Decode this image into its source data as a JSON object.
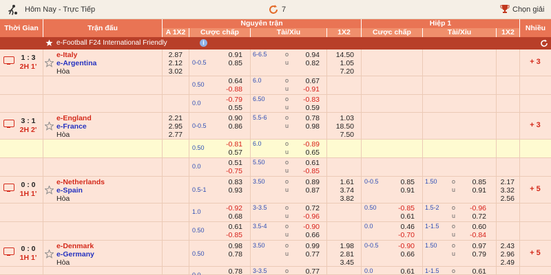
{
  "topbar": {
    "title": "Hôm Nay - Trực Tiếp",
    "count": "7",
    "choose": "Chọn giải"
  },
  "header": {
    "time": "Thời Gian",
    "match": "Trận đấu",
    "full": "Nguyên trận",
    "half": "Hiệp 1",
    "more": "Nhiều",
    "col_a1x2": "A 1X2",
    "col_handicap": "Cược chấp",
    "col_ou": "Tài/Xỉu",
    "col_1x2": "1X2",
    "col_handicap_h1": "Cược chấp",
    "col_ou_h1": "Tài/Xỉu",
    "col_1x2_h1": "1X2"
  },
  "league": {
    "name": "e-Football F24 International Friendly",
    "info": "i"
  },
  "ou_labels": {
    "over": "o",
    "under": "u"
  },
  "draw_label": "Hòa",
  "matches": [
    {
      "score": "1 : 3",
      "minute": "2H 1'",
      "home": "e-Italy",
      "away": "e-Argentina",
      "a1x2": [
        "2.87",
        "2.12",
        "3.02"
      ],
      "hc_line": "0-0.5",
      "hc_home": "0.91",
      "hc_away": "0.85",
      "ou_line": "6-6.5",
      "ou_over": "0.94",
      "ou_under": "0.82",
      "x12": [
        "14.50",
        "1.05",
        "7.20"
      ],
      "more": "+ 3",
      "subs": [
        {
          "hc_line": "0.50",
          "hc_home": "0.64",
          "hc_away": "-0.88",
          "ou_line": "6.0",
          "ou_over": "0.67",
          "ou_under": "-0.91"
        },
        {
          "hc_line": "0.0",
          "hc_home": "-0.79",
          "hc_away": "0.55",
          "ou_line": "6.50",
          "ou_over": "-0.83",
          "ou_under": "0.59"
        }
      ]
    },
    {
      "score": "3 : 1",
      "minute": "2H 2'",
      "home": "e-England",
      "away": "e-France",
      "a1x2": [
        "2.21",
        "2.95",
        "2.77"
      ],
      "hc_line": "0-0.5",
      "hc_home": "0.90",
      "hc_away": "0.86",
      "ou_line": "5.5-6",
      "ou_over": "0.78",
      "ou_under": "0.98",
      "x12": [
        "1.03",
        "18.50",
        "7.50"
      ],
      "more": "+ 3",
      "subs": [
        {
          "hc_line": "0.50",
          "hc_home": "-0.81",
          "hc_away": "0.57",
          "ou_line": "6.0",
          "ou_over": "-0.89",
          "ou_under": "0.65"
        },
        {
          "hc_line": "0.0",
          "hc_home": "0.51",
          "hc_away": "-0.75",
          "ou_line": "5.50",
          "ou_over": "0.61",
          "ou_under": "-0.85"
        }
      ]
    },
    {
      "score": "0 : 0",
      "minute": "1H 1'",
      "home": "e-Netherlands",
      "away": "e-Spain",
      "a1x2": [
        "",
        "",
        ""
      ],
      "hc_line": "0.5-1",
      "hc_home": "0.83",
      "hc_away": "0.93",
      "ou_line": "3.50",
      "ou_over": "0.89",
      "ou_under": "0.87",
      "x12": [
        "1.61",
        "3.74",
        "3.82"
      ],
      "h1": {
        "hc_line": "0-0.5",
        "hc_home": "0.85",
        "hc_away": "0.91",
        "ou_line": "1.50",
        "ou_over": "0.85",
        "ou_under": "0.91",
        "x12": [
          "2.17",
          "3.32",
          "2.56"
        ]
      },
      "more": "+ 5",
      "subs": [
        {
          "hc_line": "1.0",
          "hc_home": "-0.92",
          "hc_away": "0.68",
          "ou_line": "3-3.5",
          "ou_over": "0.72",
          "ou_under": "-0.96",
          "h1": {
            "hc_line": "0.50",
            "hc_home": "-0.85",
            "hc_away": "0.61",
            "ou_line": "1.5-2",
            "ou_over": "-0.96",
            "ou_under": "0.72"
          }
        },
        {
          "hc_line": "0.50",
          "hc_home": "0.61",
          "hc_away": "-0.85",
          "ou_line": "3.5-4",
          "ou_over": "-0.90",
          "ou_under": "0.66",
          "h1": {
            "hc_line": "0.0",
            "hc_home": "0.46",
            "hc_away": "-0.70",
            "ou_line": "1-1.5",
            "ou_over": "0.60",
            "ou_under": "-0.84"
          }
        }
      ]
    },
    {
      "score": "0 : 0",
      "minute": "1H 1'",
      "home": "e-Denmark",
      "away": "e-Germany",
      "a1x2": [
        "",
        "",
        ""
      ],
      "hc_line": "0.50",
      "hc_home": "0.98",
      "hc_away": "0.78",
      "ou_line": "3.50",
      "ou_over": "0.99",
      "ou_under": "0.77",
      "x12": [
        "1.98",
        "2.81",
        "3.45"
      ],
      "h1": {
        "hc_line": "0-0.5",
        "hc_home": "-0.90",
        "hc_away": "0.66",
        "ou_line": "1.50",
        "ou_over": "0.97",
        "ou_under": "0.79",
        "x12": [
          "2.43",
          "2.96",
          "2.49"
        ]
      },
      "more": "+ 5",
      "subs": [
        {
          "hc_line": "0.0",
          "hc_home": "0.78",
          "hc_away": "",
          "ou_line": "3-3.5",
          "ou_over": "0.77",
          "ou_under": "",
          "h1": {
            "hc_line": "0.0",
            "hc_home": "0.61",
            "hc_away": "",
            "ou_line": "1-1.5",
            "ou_over": "0.61",
            "ou_under": ""
          }
        }
      ]
    }
  ]
}
